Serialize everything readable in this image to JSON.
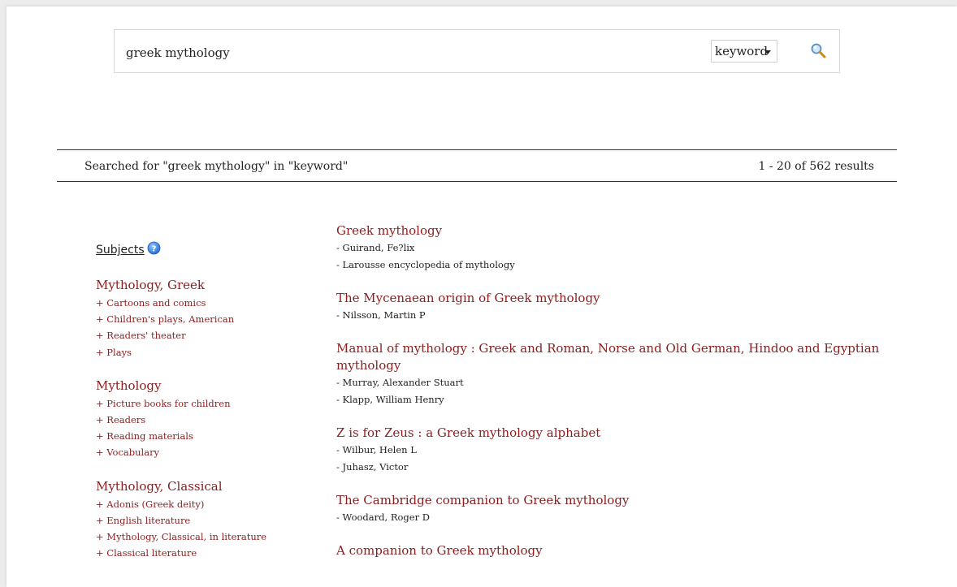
{
  "search": {
    "query": "greek mythology",
    "scope_selected": "keyword"
  },
  "status": {
    "searched_for": "Searched for \"greek mythology\" in \"keyword\"",
    "results_count": "1 - 20 of 562 results"
  },
  "facets": {
    "heading": "Subjects",
    "groups": [
      {
        "title": "Mythology, Greek",
        "items": [
          "+ Cartoons and comics",
          "+ Children's plays, American",
          "+ Readers' theater",
          "+ Plays"
        ]
      },
      {
        "title": "Mythology",
        "items": [
          "+ Picture books for children",
          "+ Readers",
          "+ Reading materials",
          "+ Vocabulary"
        ]
      },
      {
        "title": "Mythology, Classical",
        "items": [
          "+ Adonis (Greek deity)",
          "+ English literature",
          "+ Mythology, Classical, in literature",
          "+ Classical literature"
        ]
      }
    ]
  },
  "results": [
    {
      "title": "Greek mythology",
      "authors": [
        "- Guirand, Fe?lix",
        "- Larousse encyclopedia of mythology"
      ]
    },
    {
      "title": "The Mycenaean origin of Greek mythology",
      "authors": [
        "- Nilsson, Martin P"
      ]
    },
    {
      "title": "Manual of mythology : Greek and Roman, Norse and Old German, Hindoo and Egyptian mythology",
      "authors": [
        "- Murray, Alexander Stuart",
        "- Klapp, William Henry"
      ]
    },
    {
      "title": "Z is for Zeus : a Greek mythology alphabet",
      "authors": [
        "- Wilbur, Helen L",
        "- Juhasz, Victor"
      ]
    },
    {
      "title": "The Cambridge companion to Greek mythology",
      "authors": [
        "- Woodard, Roger D"
      ]
    },
    {
      "title": "A companion to Greek mythology",
      "authors": []
    }
  ]
}
